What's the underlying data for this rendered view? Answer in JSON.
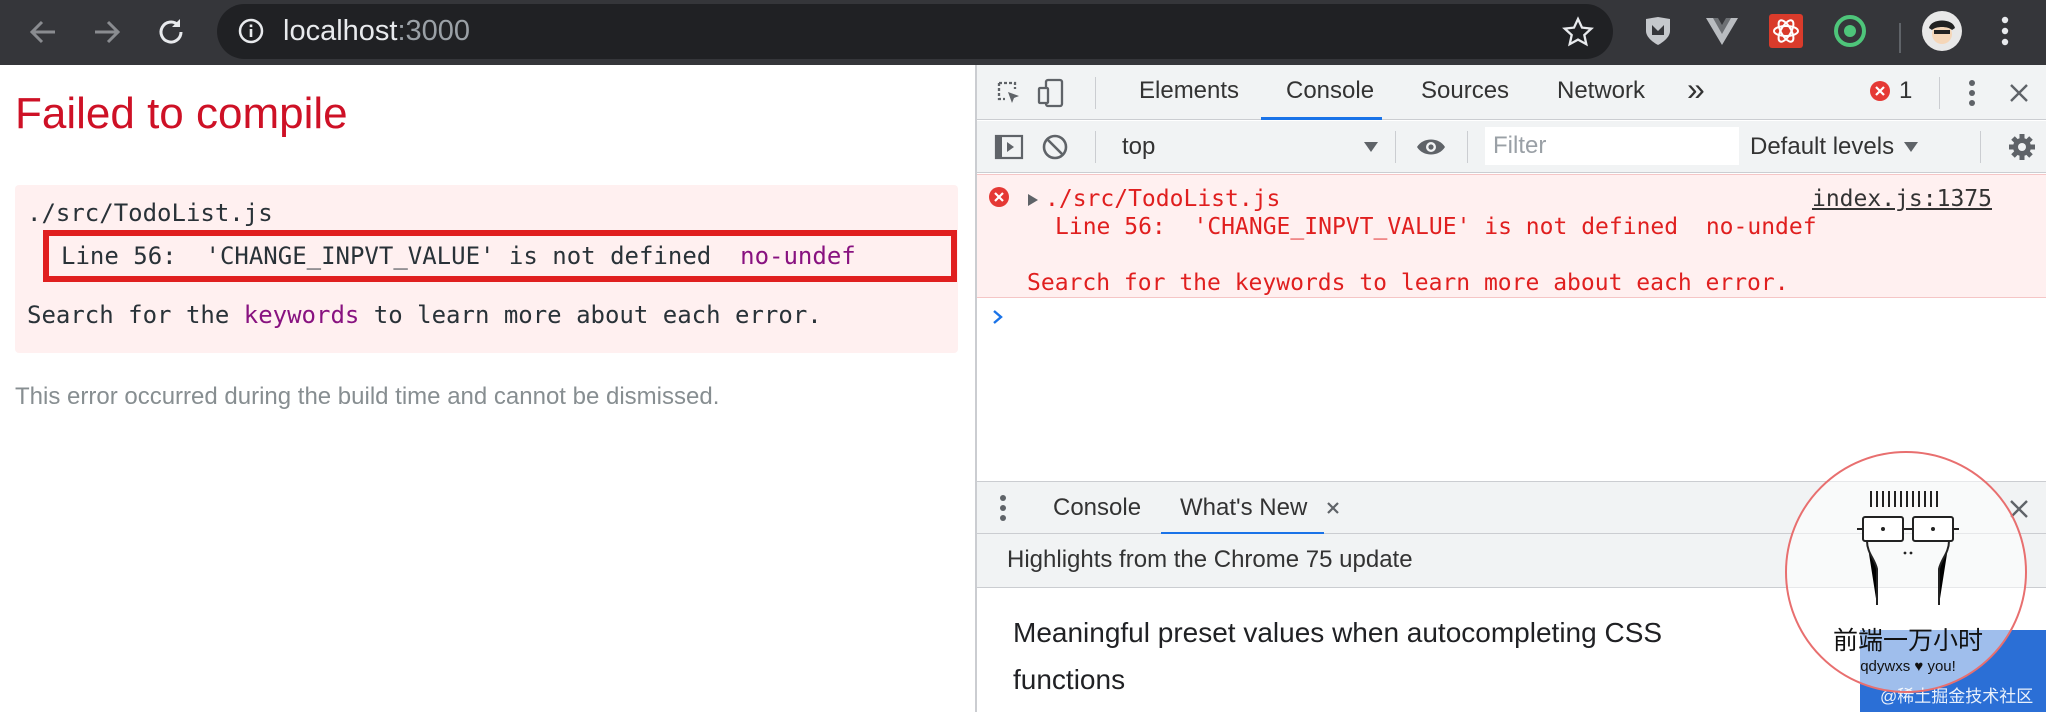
{
  "browser": {
    "url_host": "localhost",
    "url_port": ":3000"
  },
  "page": {
    "title": "Failed to compile",
    "file": "./src/TodoList.js",
    "error_line": "Line 56:  'CHANGE_INPVT_VALUE' is not defined  ",
    "error_rule": "no-undef",
    "hint_prefix": "Search for the ",
    "hint_link": "keywords",
    "hint_suffix": " to learn more about each error.",
    "footer": "This error occurred during the build time and cannot be dismissed."
  },
  "devtools": {
    "tabs": [
      "Elements",
      "Console",
      "Sources",
      "Network"
    ],
    "active_tab": "Console",
    "more_tabs_glyph": "»",
    "error_count": "1",
    "context": "top",
    "filter_placeholder": "Filter",
    "levels": "Default levels",
    "console_error": {
      "file": "./src/TodoList.js",
      "line": "Line 56:  'CHANGE_INPVT_VALUE' is not defined  no-undef",
      "hint": "Search for the keywords to learn more about each error.",
      "source": "index.js:1375"
    },
    "drawer": {
      "tabs": [
        "Console",
        "What's New"
      ],
      "active_tab": "What's New",
      "subheader": "Highlights from the Chrome 75 update",
      "news_text": "Meaningful preset values when autocompleting CSS functions"
    }
  },
  "watermark": {
    "name": "前端一万小时",
    "tagline": "qdywxs ♥ you!",
    "corner_text": "@稀土掘金技术社区"
  },
  "colors": {
    "error_red": "#ce1126",
    "highlight_border": "#e01f1f",
    "keyword_purple": "#881280",
    "active_blue": "#1a73e8"
  }
}
